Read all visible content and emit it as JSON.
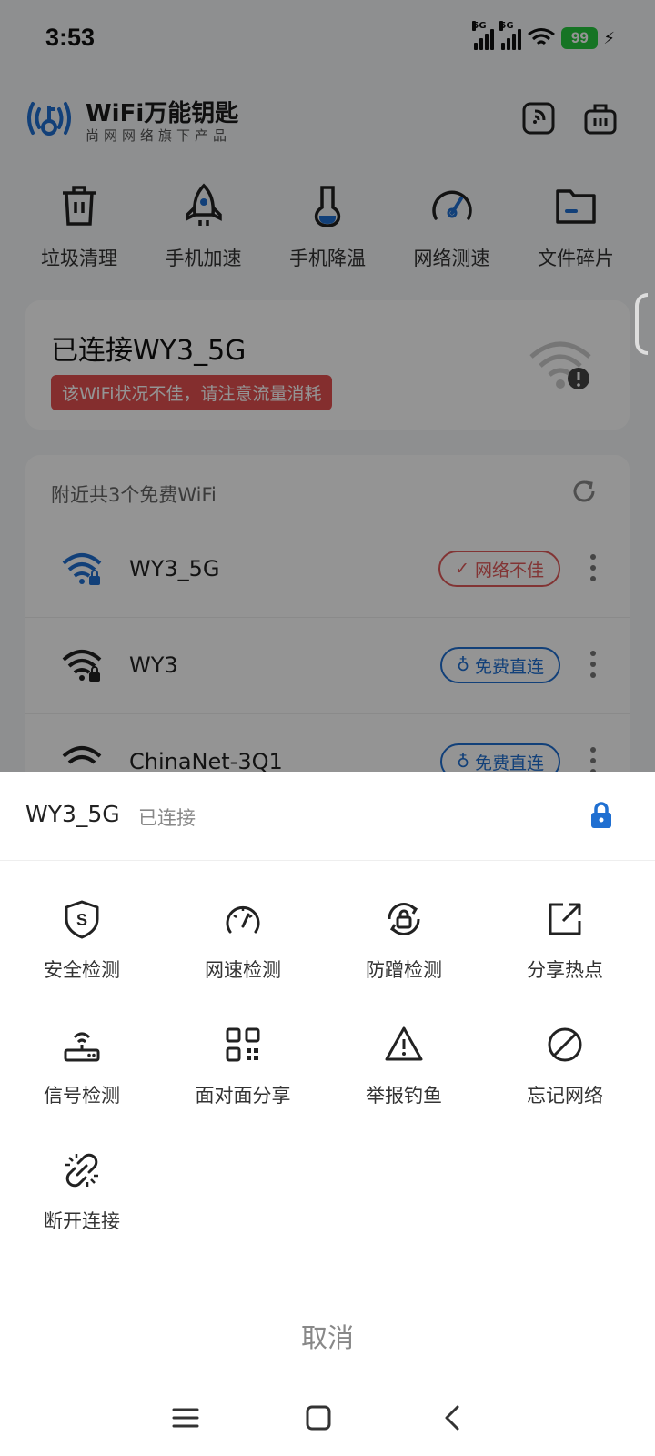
{
  "status_bar": {
    "time": "3:53",
    "sim1": "5G",
    "sim2": "5G",
    "battery": "99"
  },
  "header": {
    "brand": "WiFi万能钥匙",
    "subtitle": "尚网网络旗下产品"
  },
  "tools": [
    {
      "label": "垃圾清理",
      "icon": "trash-icon"
    },
    {
      "label": "手机加速",
      "icon": "rocket-icon"
    },
    {
      "label": "手机降温",
      "icon": "thermometer-icon"
    },
    {
      "label": "网络测速",
      "icon": "speedometer-icon"
    },
    {
      "label": "文件碎片",
      "icon": "folder-icon"
    }
  ],
  "connected": {
    "title": "已连接WY3_5G",
    "warning": "该WiFi状况不佳，请注意流量消耗"
  },
  "nearby": {
    "title": "附近共3个免费WiFi",
    "networks": [
      {
        "name": "WY3_5G",
        "badge": "网络不佳",
        "badge_type": "bad"
      },
      {
        "name": "WY3",
        "badge": "免费直连",
        "badge_type": "free"
      },
      {
        "name": "ChinaNet-3Q1",
        "badge": "免费直连",
        "badge_type": "free"
      }
    ]
  },
  "sheet": {
    "ssid": "WY3_5G",
    "status": "已连接",
    "actions": [
      {
        "label": "安全检测",
        "icon": "shield-icon"
      },
      {
        "label": "网速检测",
        "icon": "speedometer-icon"
      },
      {
        "label": "防蹭检测",
        "icon": "lock-refresh-icon"
      },
      {
        "label": "分享热点",
        "icon": "share-icon"
      },
      {
        "label": "信号检测",
        "icon": "router-icon"
      },
      {
        "label": "面对面分享",
        "icon": "qr-code-icon"
      },
      {
        "label": "举报钓鱼",
        "icon": "warning-icon"
      },
      {
        "label": "忘记网络",
        "icon": "forbidden-icon"
      },
      {
        "label": "断开连接",
        "icon": "unlink-icon"
      }
    ],
    "cancel": "取消"
  },
  "colors": {
    "accent": "#1f6fd1",
    "warning": "#e35050",
    "battery": "#27c93f"
  }
}
